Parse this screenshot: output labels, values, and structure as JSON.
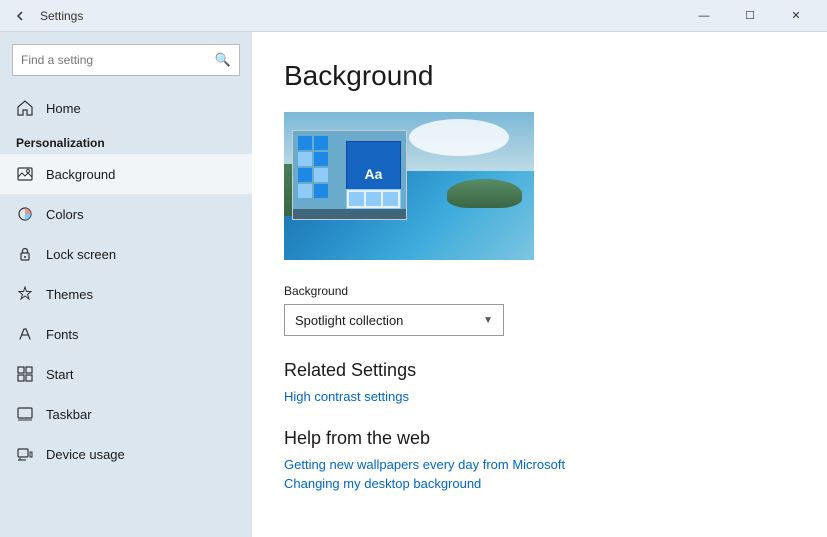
{
  "titleBar": {
    "title": "Settings",
    "minimizeLabel": "—",
    "maximizeLabel": "☐",
    "closeLabel": "✕"
  },
  "sidebar": {
    "searchPlaceholder": "Find a setting",
    "sectionLabel": "Personalization",
    "items": [
      {
        "id": "home",
        "label": "Home",
        "icon": "home"
      },
      {
        "id": "background",
        "label": "Background",
        "icon": "background",
        "active": true
      },
      {
        "id": "colors",
        "label": "Colors",
        "icon": "colors"
      },
      {
        "id": "lock-screen",
        "label": "Lock screen",
        "icon": "lock"
      },
      {
        "id": "themes",
        "label": "Themes",
        "icon": "themes"
      },
      {
        "id": "fonts",
        "label": "Fonts",
        "icon": "fonts"
      },
      {
        "id": "start",
        "label": "Start",
        "icon": "start"
      },
      {
        "id": "taskbar",
        "label": "Taskbar",
        "icon": "taskbar"
      },
      {
        "id": "device-usage",
        "label": "Device usage",
        "icon": "device"
      }
    ]
  },
  "main": {
    "pageTitle": "Background",
    "formLabel": "Background",
    "dropdownValue": "Spotlight collection",
    "relatedSettingsTitle": "Related Settings",
    "relatedLinks": [
      {
        "label": "High contrast settings"
      }
    ],
    "helpTitle": "Help from the web",
    "helpLinks": [
      {
        "label": "Getting new wallpapers every day from Microsoft"
      },
      {
        "label": "Changing my desktop background"
      }
    ]
  }
}
